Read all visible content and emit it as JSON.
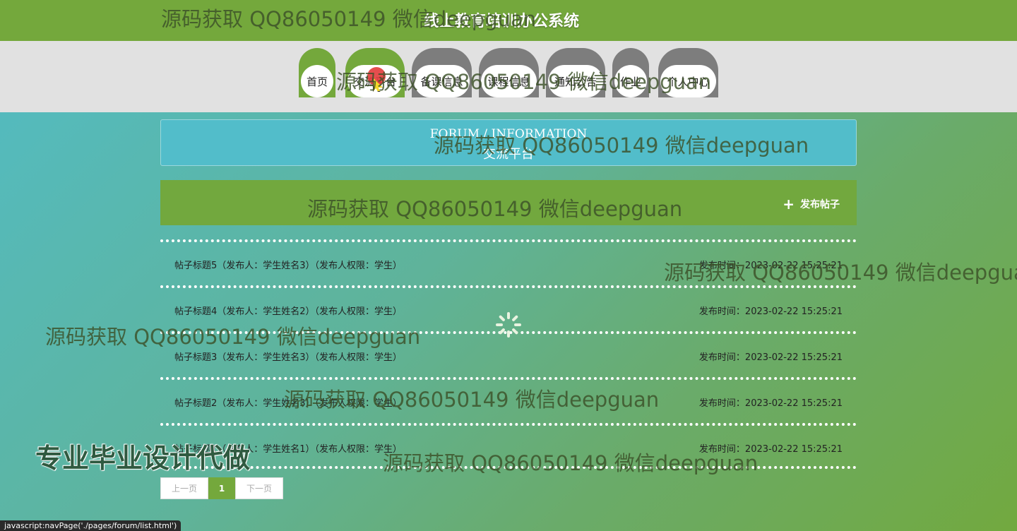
{
  "header": {
    "site_title": "线上教育培训办公系统"
  },
  "nav": {
    "items": [
      {
        "label": "首页"
      },
      {
        "label": "交流平台"
      },
      {
        "label": "备课信息"
      },
      {
        "label": "课程信息"
      },
      {
        "label": "通知公告"
      },
      {
        "label": "作业"
      },
      {
        "label": "个人中心"
      }
    ],
    "active_index": 1
  },
  "banner": {
    "title_en": "FORUM / INFORMATION",
    "title_zh": "交流平台"
  },
  "toolbar": {
    "post_label": "发布帖子",
    "post_icon": "plus-icon"
  },
  "posts": [
    {
      "title": "帖子标题5（发布人：学生姓名3）（发布人权限：学生）",
      "time": "发布时间：2023-02-22 15:25:21"
    },
    {
      "title": "帖子标题4（发布人：学生姓名2）（发布人权限：学生）",
      "time": "发布时间：2023-02-22 15:25:21"
    },
    {
      "title": "帖子标题3（发布人：学生姓名3）（发布人权限：学生）",
      "time": "发布时间：2023-02-22 15:25:21"
    },
    {
      "title": "帖子标题2（发布人：学生姓名3）（发布人权限：学生）",
      "time": "发布时间：2023-02-22 15:25:21"
    },
    {
      "title": "帖子标题1（发布人：学生姓名1）（发布人权限：学生）",
      "time": "发布时间：2023-02-22 15:25:21"
    }
  ],
  "pagination": {
    "prev_label": "上一页",
    "current_page": "1",
    "next_label": "下一页"
  },
  "status_bar": {
    "url": "javascript:navPage('./pages/forum/list.html')"
  },
  "overlay": {
    "watermark_text": "源码获取 QQ86050149 微信deepguan",
    "promo_text": "专业毕业设计代做"
  },
  "colors": {
    "brand_green": "#74a83c",
    "nav_inactive": "#7d7d7d",
    "banner_teal": "#52bdca"
  }
}
